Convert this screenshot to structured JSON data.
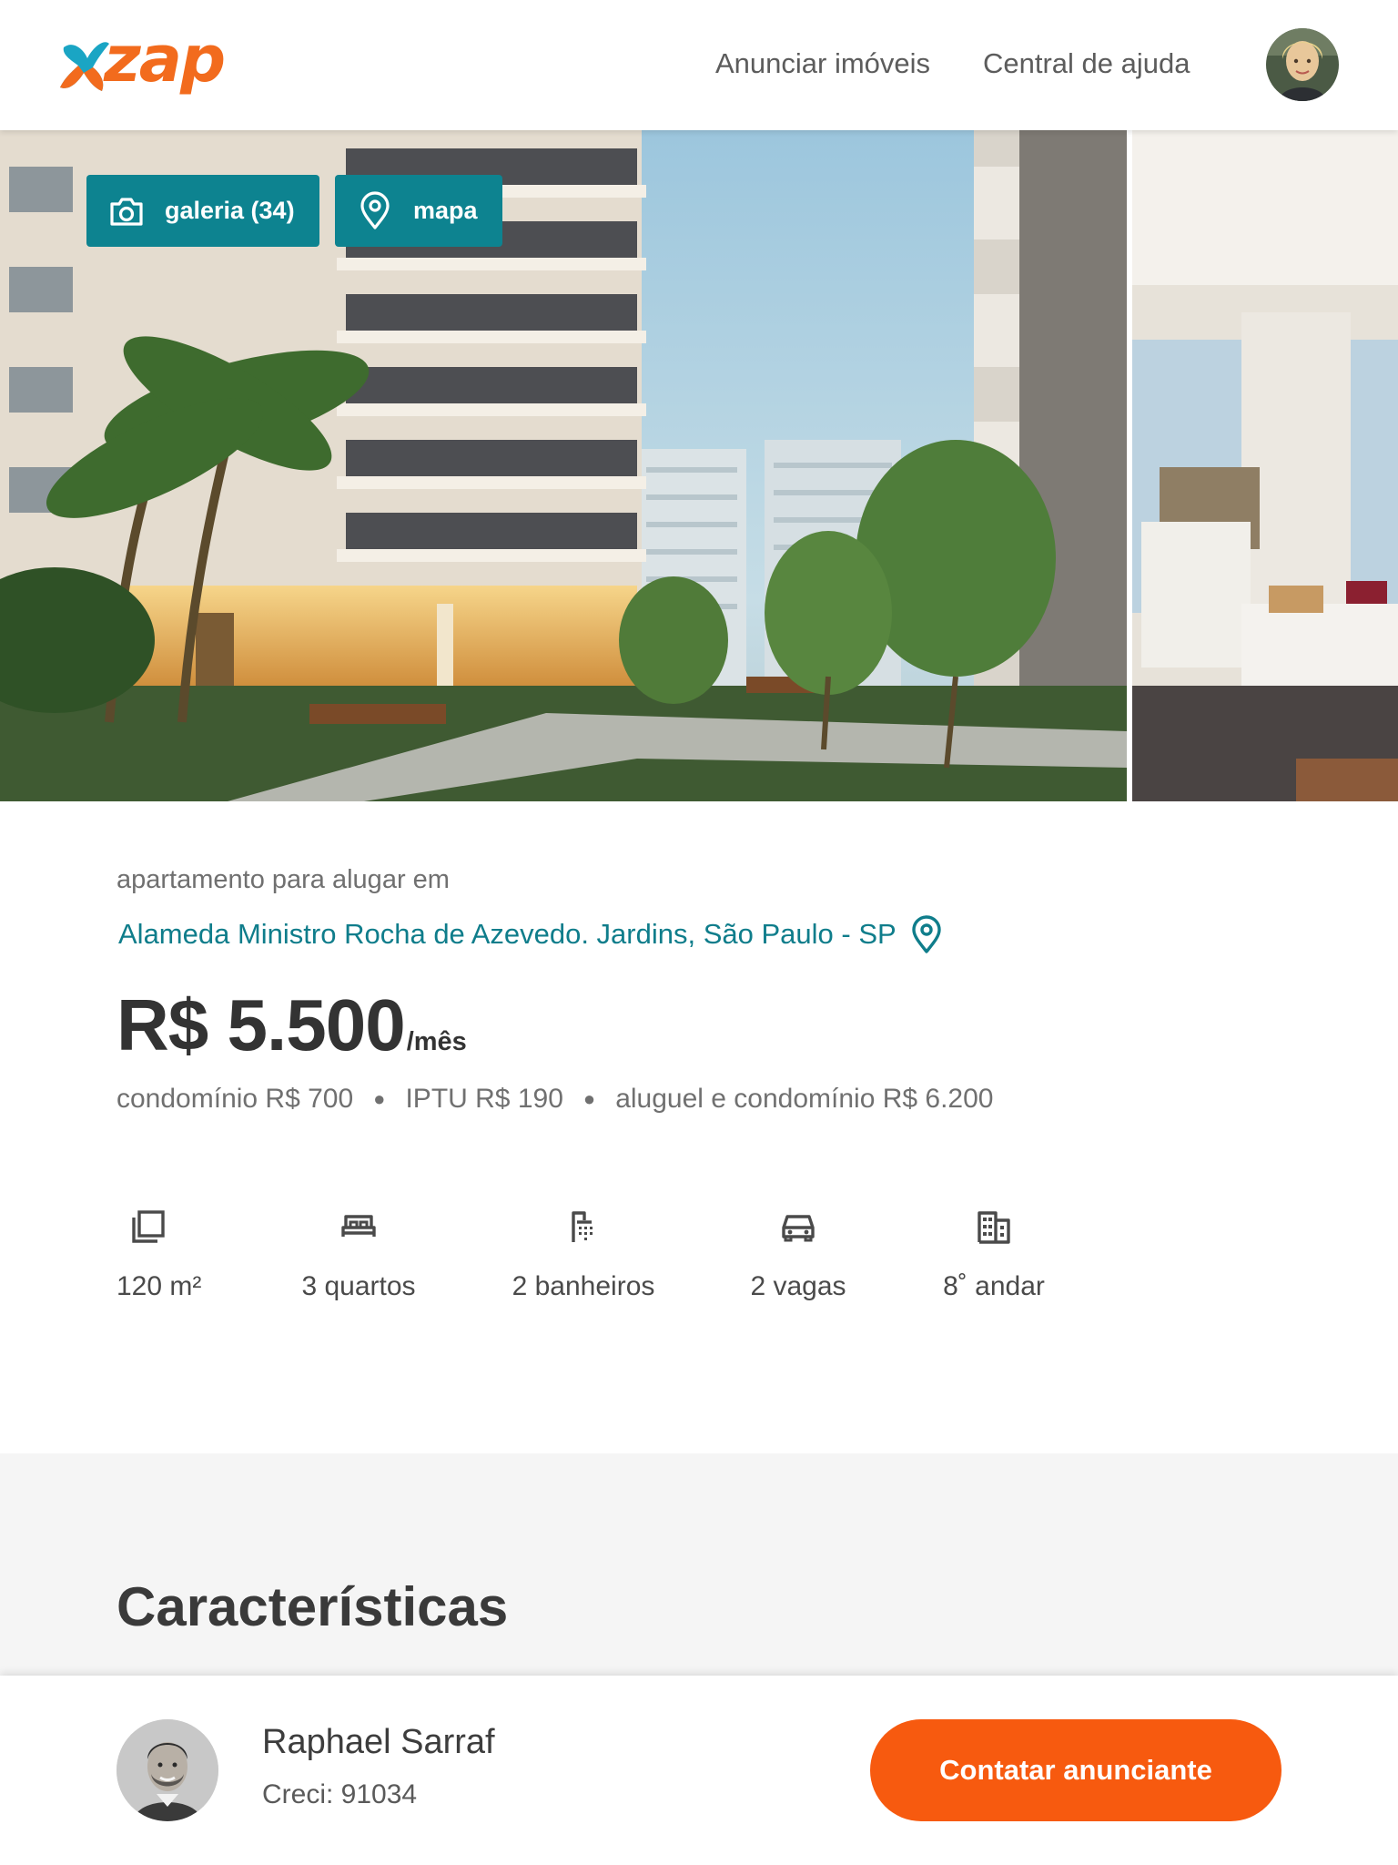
{
  "header": {
    "logo_text": "zap",
    "nav": [
      {
        "label": "Anunciar imóveis"
      },
      {
        "label": "Central de ajuda"
      }
    ]
  },
  "gallery": {
    "gallery_label": "galeria (34)",
    "map_label": "mapa"
  },
  "listing": {
    "subtitle": "apartamento para alugar em",
    "address": "Alameda Ministro Rocha de Azevedo. Jardins, São Paulo - SP",
    "price": "R$ 5.500",
    "price_unit": "/mês",
    "costs": [
      "condomínio R$ 700",
      "IPTU R$ 190",
      "aluguel e condomínio R$ 6.200"
    ],
    "features": [
      {
        "icon": "area-icon",
        "label": "120 m²"
      },
      {
        "icon": "bed-icon",
        "label": "3 quartos"
      },
      {
        "icon": "shower-icon",
        "label": "2 banheiros"
      },
      {
        "icon": "car-icon",
        "label": "2 vagas"
      },
      {
        "icon": "building-icon",
        "label": "8˚ andar"
      }
    ]
  },
  "characteristics": {
    "title": "Características"
  },
  "contact": {
    "agent_name": "Raphael Sarraf",
    "creci": "Creci: 91034",
    "button_label": "Contatar anunciante"
  },
  "colors": {
    "brand_orange": "#f75a0f",
    "teal": "#0d8390",
    "link_teal": "#0f7d8b"
  }
}
